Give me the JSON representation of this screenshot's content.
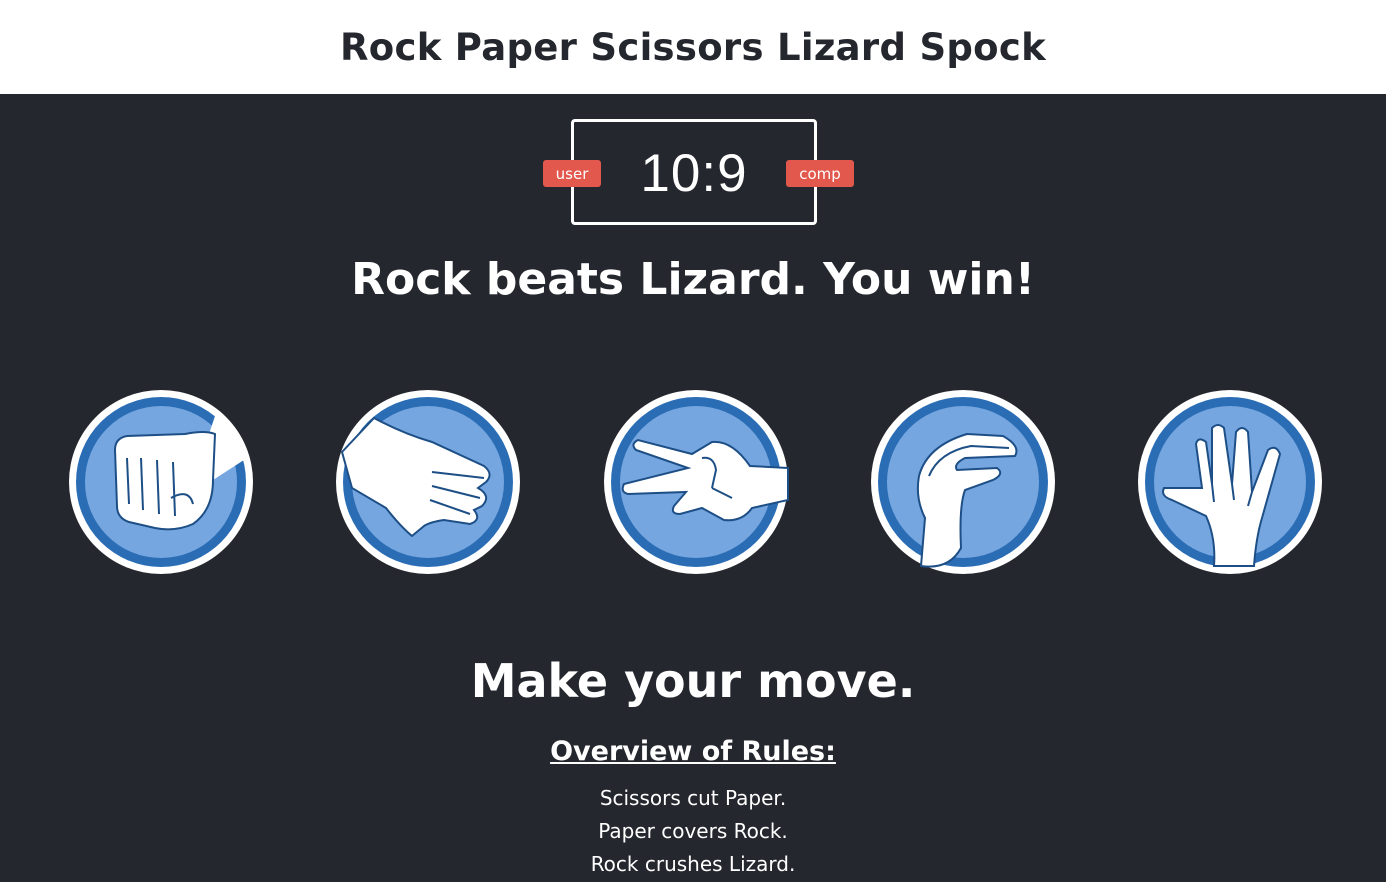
{
  "header": {
    "title": "Rock Paper Scissors Lizard Spock"
  },
  "scoreboard": {
    "user_label": "user",
    "comp_label": "comp",
    "score": "10:9",
    "user_score": 10,
    "comp_score": 9
  },
  "result_message": "Rock beats Lizard. You win!",
  "choices": [
    {
      "name": "rock",
      "icon": "rock-fist-icon"
    },
    {
      "name": "paper",
      "icon": "paper-hand-icon"
    },
    {
      "name": "scissors",
      "icon": "scissors-hand-icon"
    },
    {
      "name": "lizard",
      "icon": "lizard-hand-icon"
    },
    {
      "name": "spock",
      "icon": "spock-hand-icon"
    }
  ],
  "prompt": "Make your move.",
  "rules": {
    "title": "Overview of Rules:",
    "items": [
      "Scissors cut Paper.",
      "Paper covers Rock.",
      "Rock crushes Lizard."
    ]
  },
  "colors": {
    "background": "#25272e",
    "header_bg": "#ffffff",
    "badge": "#e2584d",
    "circle_ring": "#2a6db5",
    "circle_fill": "#76a6e0"
  }
}
